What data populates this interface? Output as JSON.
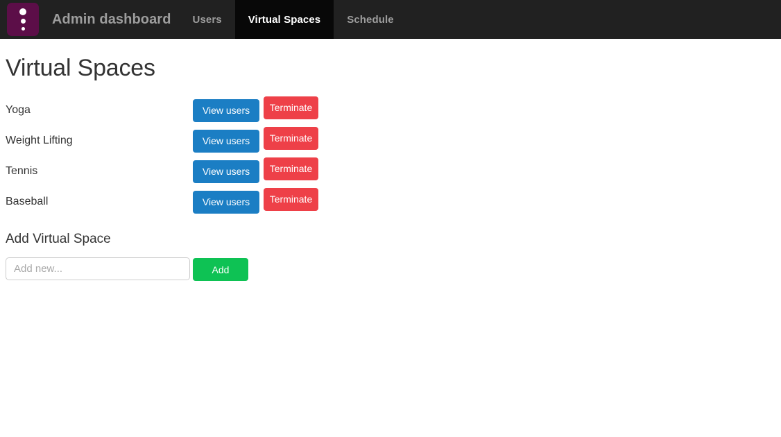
{
  "navbar": {
    "logo_icon": "three-dots-logo-icon",
    "brand": "Admin dashboard",
    "links": [
      {
        "label": "Users",
        "active": false
      },
      {
        "label": "Virtual Spaces",
        "active": true
      },
      {
        "label": "Schedule",
        "active": false
      }
    ],
    "colors": {
      "background": "#212121",
      "active_background": "#080808",
      "logo_background": "#5c0e48",
      "text": "#9d9d9d",
      "active_text": "#ffffff"
    }
  },
  "page": {
    "title": "Virtual Spaces"
  },
  "spaces": {
    "view_users_label": "View users",
    "terminate_label": "Terminate",
    "rows": [
      {
        "name": "Yoga"
      },
      {
        "name": "Weight Lifting"
      },
      {
        "name": "Tennis"
      },
      {
        "name": "Baseball"
      }
    ]
  },
  "add_section": {
    "title": "Add Virtual Space",
    "input_value": "",
    "input_placeholder": "Add new...",
    "add_label": "Add"
  },
  "colors": {
    "primary_blue": "#1b7ec4",
    "danger_red": "#ee4048",
    "success_green": "#0ec254",
    "body_text": "#333333",
    "input_border": "#cccccc",
    "placeholder": "#a9a9a9"
  }
}
